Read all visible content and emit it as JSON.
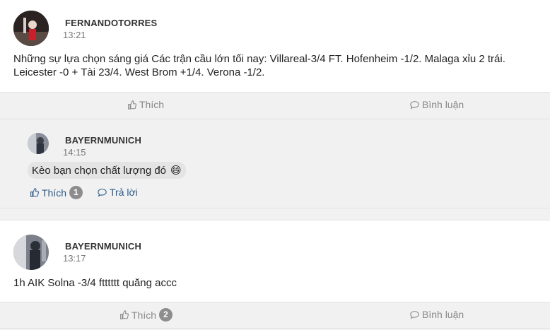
{
  "post1": {
    "author": "FERNANDOTORRES",
    "time": "13:21",
    "text": "Những sự lựa chọn sáng giá Các trận cầu lớn tối nay: Villareal-3/4 FT. Hofenheim -1/2. Malaga xỉu 2 trái. Leicester -0 + Tài 23/4. West Brom +1/4. Verona -1/2.",
    "like_label": "Thích",
    "comment_label": "Bình luận"
  },
  "comment1": {
    "author": "BAYERNMUNICH",
    "time": "14:15",
    "text": "Kèo bạn chọn chất lượng đó",
    "emoji": "😄",
    "like_label": "Thích",
    "like_count": "1",
    "reply_label": "Trả lời"
  },
  "post2": {
    "author": "BAYERNMUNICH",
    "time": "13:17",
    "text": "1h AIK Solna -3/4 ftttttt quăng accc",
    "like_label": "Thích",
    "like_count": "2",
    "comment_label": "Bình luận"
  },
  "colors": {
    "link": "#2a5b8c",
    "muted": "#888888",
    "badge": "#8d8d8d"
  }
}
